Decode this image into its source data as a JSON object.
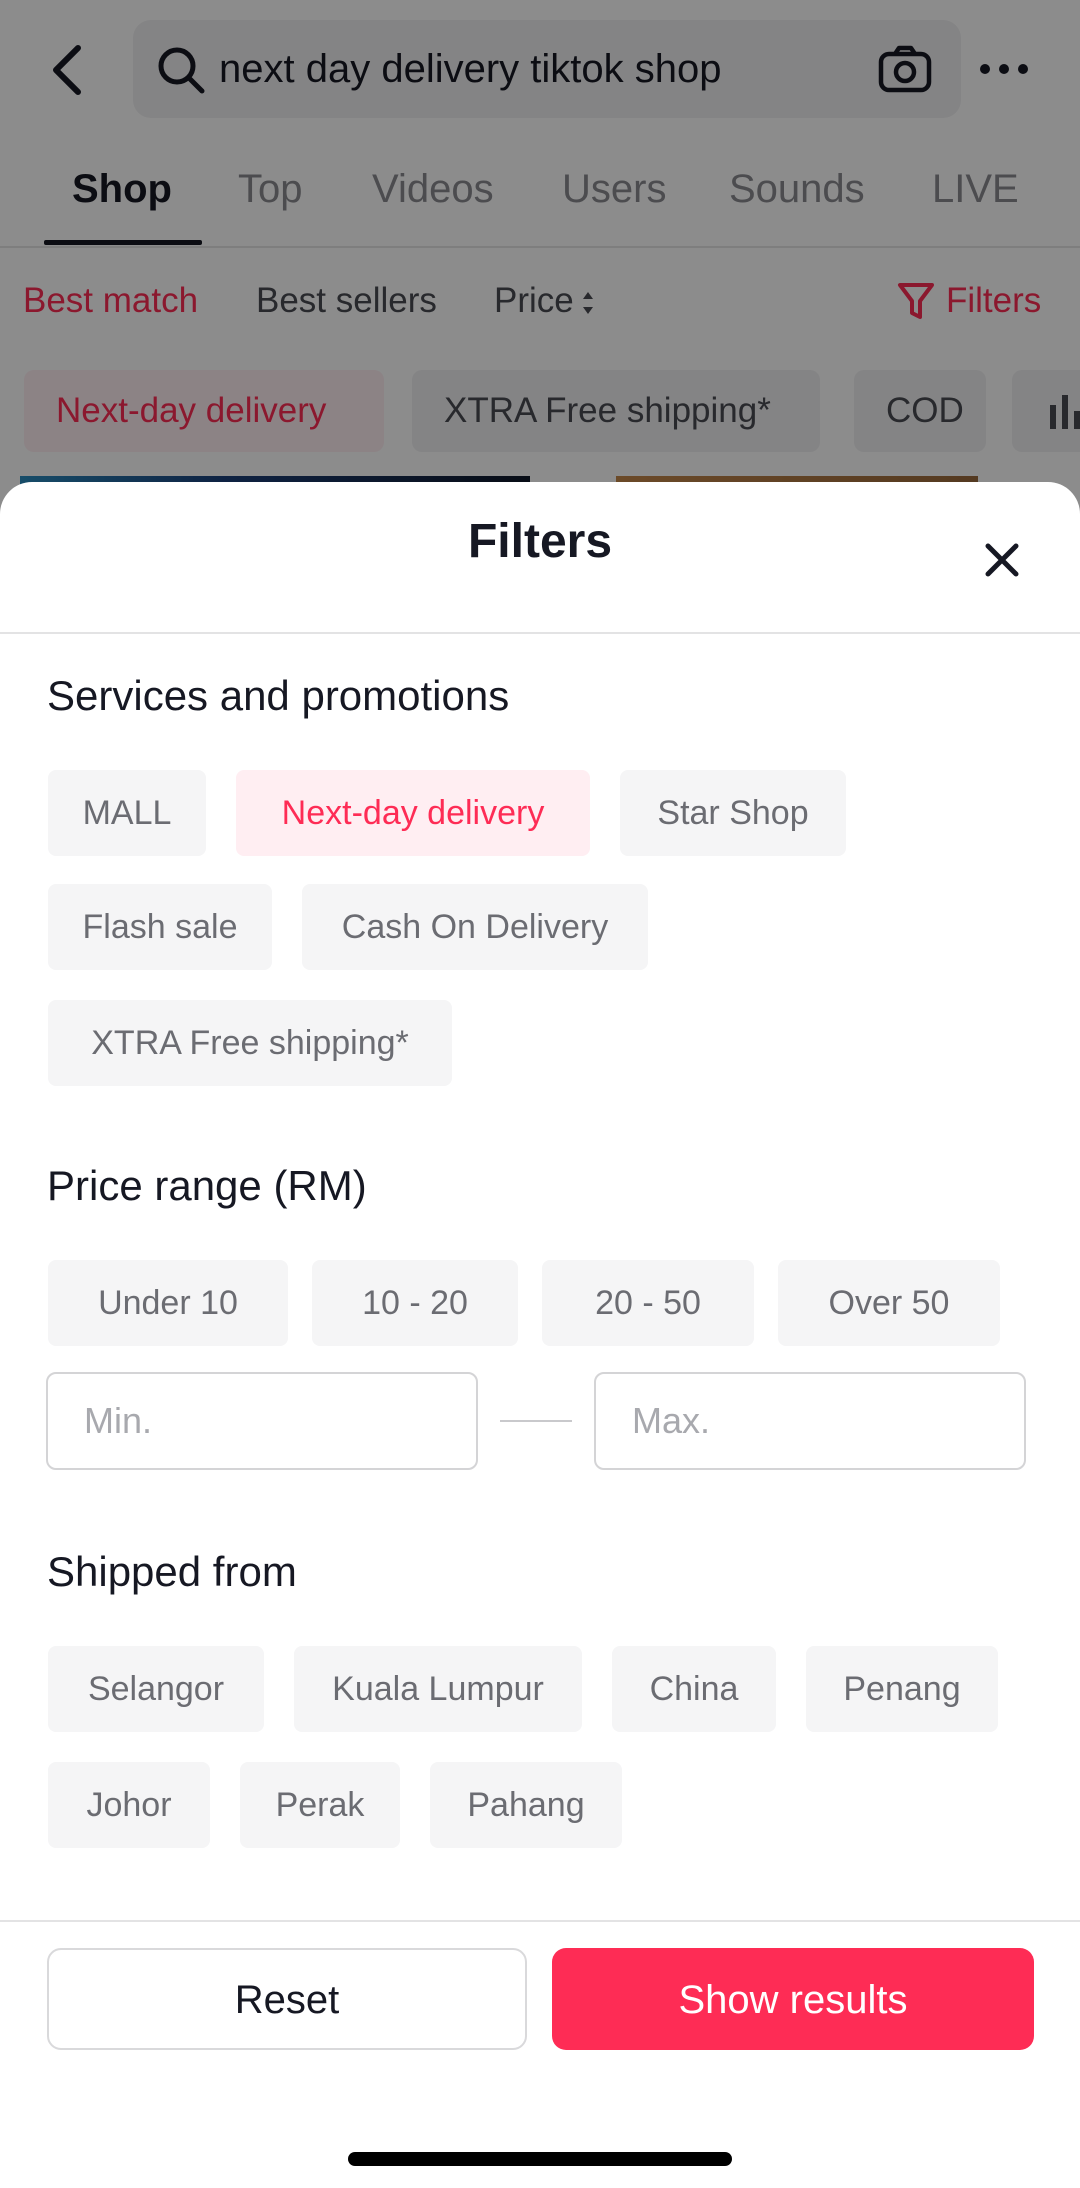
{
  "search": {
    "query": "next day delivery tiktok shop"
  },
  "tabs": [
    {
      "label": "Shop"
    },
    {
      "label": "Top"
    },
    {
      "label": "Videos"
    },
    {
      "label": "Users"
    },
    {
      "label": "Sounds"
    },
    {
      "label": "LIVE"
    }
  ],
  "sort": {
    "best_match": "Best match",
    "best_sellers": "Best sellers",
    "price": "Price",
    "filters": "Filters"
  },
  "quick_filters": [
    {
      "label": "Next-day delivery",
      "active": true
    },
    {
      "label": "XTRA Free shipping*",
      "active": false
    },
    {
      "label": "COD",
      "active": false
    }
  ],
  "sheet": {
    "title": "Filters",
    "services": {
      "title": "Services and promotions",
      "options": [
        {
          "label": "MALL",
          "selected": false
        },
        {
          "label": "Next-day delivery",
          "selected": true
        },
        {
          "label": "Star Shop",
          "selected": false
        },
        {
          "label": "Flash sale",
          "selected": false
        },
        {
          "label": "Cash On Delivery",
          "selected": false
        },
        {
          "label": "XTRA Free shipping*",
          "selected": false
        }
      ]
    },
    "price": {
      "title": "Price range (RM)",
      "options": [
        {
          "label": "Under 10"
        },
        {
          "label": "10 - 20"
        },
        {
          "label": "20 - 50"
        },
        {
          "label": "Over 50"
        }
      ],
      "min_placeholder": "Min.",
      "max_placeholder": "Max."
    },
    "shipped_from": {
      "title": "Shipped from",
      "options": [
        {
          "label": "Selangor"
        },
        {
          "label": "Kuala Lumpur"
        },
        {
          "label": "China"
        },
        {
          "label": "Penang"
        },
        {
          "label": "Johor"
        },
        {
          "label": "Perak"
        },
        {
          "label": "Pahang"
        }
      ]
    },
    "reset_label": "Reset",
    "show_results_label": "Show results"
  },
  "colors": {
    "accent": "#fe2c55",
    "accent_bg": "#ffeef2",
    "chip_bg": "#f5f5f6"
  }
}
